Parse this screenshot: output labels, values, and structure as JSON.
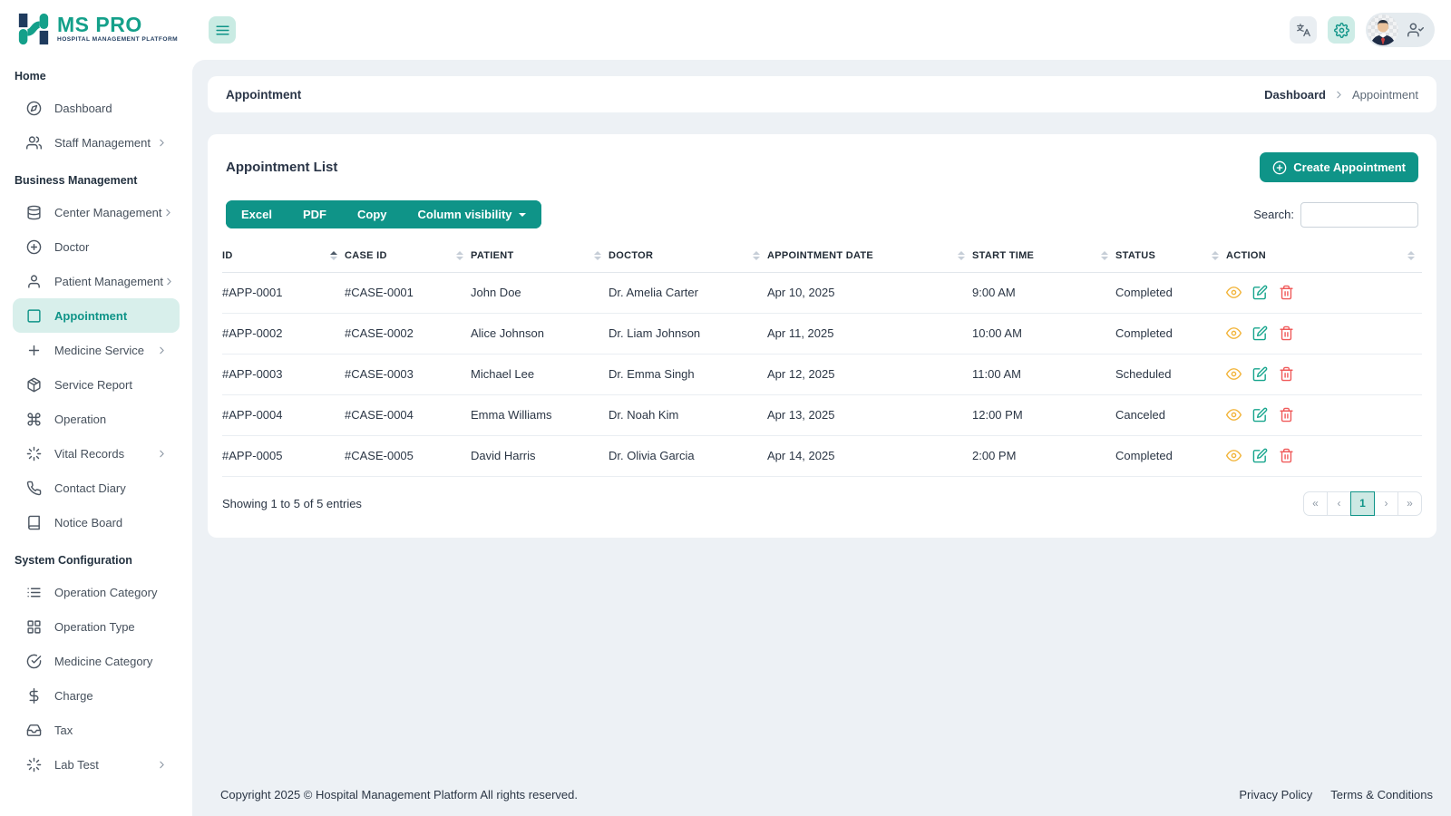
{
  "brand": {
    "name": "MS PRO",
    "tagline": "HOSPITAL MANAGEMENT PLATFORM"
  },
  "header": {
    "icons": [
      "menu",
      "translate",
      "settings",
      "user-check"
    ]
  },
  "sidebar": {
    "sections": [
      {
        "label": "Home",
        "items": [
          {
            "label": "Dashboard",
            "icon": "gauge"
          },
          {
            "label": "Staff Management",
            "icon": "users",
            "chevron": true
          }
        ]
      },
      {
        "label": "Business Management",
        "items": [
          {
            "label": "Center Management",
            "icon": "database",
            "chevron": true
          },
          {
            "label": "Doctor",
            "icon": "plus-circle"
          },
          {
            "label": "Patient Management",
            "icon": "user",
            "chevron": true
          },
          {
            "label": "Appointment",
            "icon": "square",
            "active": true
          },
          {
            "label": "Medicine Service",
            "icon": "plus",
            "chevron": true
          },
          {
            "label": "Service Report",
            "icon": "package"
          },
          {
            "label": "Operation",
            "icon": "command"
          },
          {
            "label": "Vital Records",
            "icon": "loader",
            "chevron": true
          },
          {
            "label": "Contact Diary",
            "icon": "phone"
          },
          {
            "label": "Notice Board",
            "icon": "book"
          }
        ]
      },
      {
        "label": "System Configuration",
        "items": [
          {
            "label": "Operation Category",
            "icon": "list"
          },
          {
            "label": "Operation Type",
            "icon": "grid"
          },
          {
            "label": "Medicine Category",
            "icon": "check-circle"
          },
          {
            "label": "Charge",
            "icon": "dollar-sign"
          },
          {
            "label": "Tax",
            "icon": "inbox"
          },
          {
            "label": "Lab Test",
            "icon": "loader",
            "chevron": true
          }
        ]
      }
    ]
  },
  "page": {
    "title": "Appointment",
    "breadcrumb": {
      "parent": "Dashboard",
      "current": "Appointment"
    }
  },
  "panel": {
    "title": "Appointment List",
    "create_button": "Create Appointment",
    "export_buttons": [
      "Excel",
      "PDF",
      "Copy"
    ],
    "colvis_label": "Column visibility",
    "search_label": "Search:",
    "search_value": "",
    "table": {
      "columns": [
        {
          "label": "ID",
          "sorted": "asc"
        },
        {
          "label": "CASE ID"
        },
        {
          "label": "PATIENT"
        },
        {
          "label": "DOCTOR"
        },
        {
          "label": "APPOINTMENT DATE"
        },
        {
          "label": "START TIME"
        },
        {
          "label": "STATUS"
        },
        {
          "label": "ACTION"
        }
      ],
      "action_icons": [
        "eye",
        "edit",
        "trash"
      ],
      "rows": [
        {
          "id": "#APP-0001",
          "case_id": "#CASE-0001",
          "patient": "John Doe",
          "doctor": "Dr. Amelia Carter",
          "date": "Apr 10, 2025",
          "time": "9:00 AM",
          "status": "Completed"
        },
        {
          "id": "#APP-0002",
          "case_id": "#CASE-0002",
          "patient": "Alice Johnson",
          "doctor": "Dr. Liam Johnson",
          "date": "Apr 11, 2025",
          "time": "10:00 AM",
          "status": "Completed"
        },
        {
          "id": "#APP-0003",
          "case_id": "#CASE-0003",
          "patient": "Michael Lee",
          "doctor": "Dr. Emma Singh",
          "date": "Apr 12, 2025",
          "time": "11:00 AM",
          "status": "Scheduled"
        },
        {
          "id": "#APP-0004",
          "case_id": "#CASE-0004",
          "patient": "Emma Williams",
          "doctor": "Dr. Noah Kim",
          "date": "Apr 13, 2025",
          "time": "12:00 PM",
          "status": "Canceled"
        },
        {
          "id": "#APP-0005",
          "case_id": "#CASE-0005",
          "patient": "David Harris",
          "doctor": "Dr. Olivia Garcia",
          "date": "Apr 14, 2025",
          "time": "2:00 PM",
          "status": "Completed"
        }
      ]
    },
    "entries_info": "Showing 1 to 5 of 5 entries",
    "pagination": {
      "first": "«",
      "prev": "‹",
      "current": "1",
      "next": "›",
      "last": "»"
    }
  },
  "footer": {
    "copyright": "Copyright 2025 © Hospital Management Platform All rights reserved.",
    "links": [
      "Privacy Policy",
      "Terms & Conditions"
    ]
  },
  "colors": {
    "primary": "#0f9488",
    "primary_light": "#d8efeb",
    "main_bg": "#edf1f5",
    "view_icon": "#f2b53c",
    "edit_icon": "#17a58d",
    "delete_icon": "#f05b5b"
  }
}
